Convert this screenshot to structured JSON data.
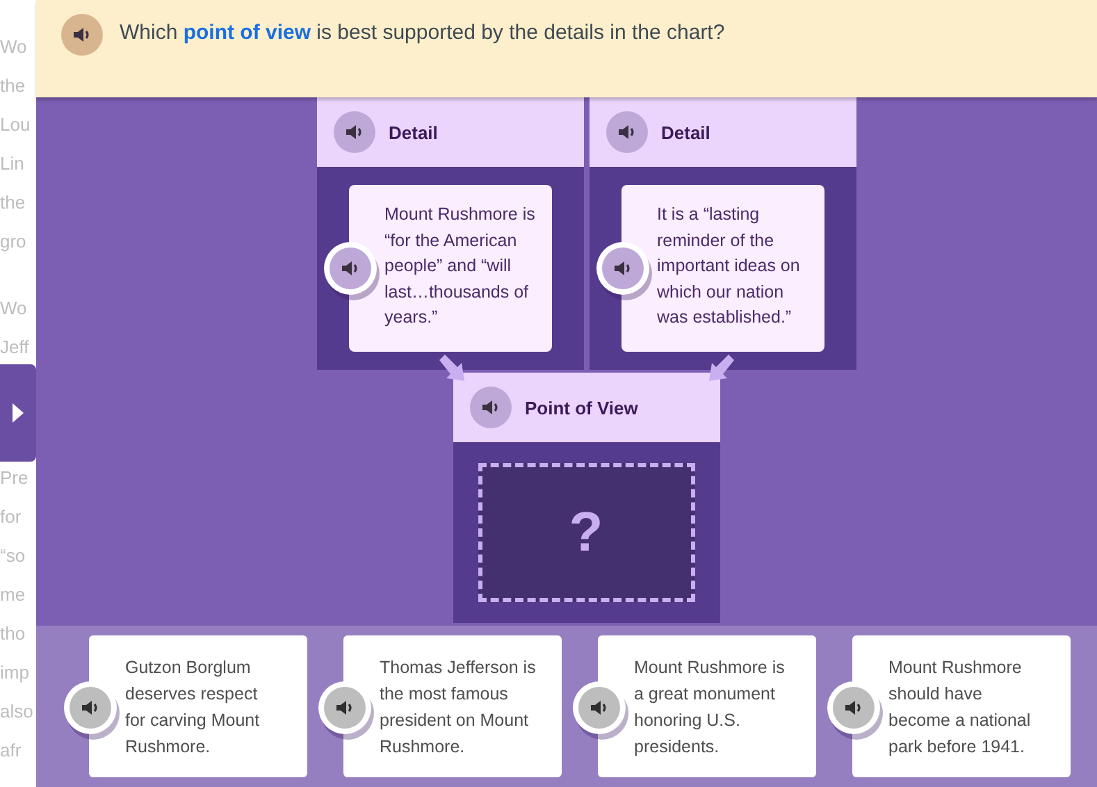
{
  "background_text": {
    "paragraphs": [
      [
        "Wo",
        "the",
        "Lou",
        "Lin",
        "the",
        "gro"
      ],
      [
        "Wo",
        "Jeff"
      ],
      [
        "Pre",
        "for",
        "“so",
        "me",
        "tho",
        "imp",
        "also",
        "afr"
      ]
    ]
  },
  "question": {
    "text": "Which **point of view** is best supported by the details in the chart?"
  },
  "chart": {
    "details": [
      {
        "heading": "Detail",
        "text": "Mount Rushmore is “for the American people” and “will last…thousands of years.”"
      },
      {
        "heading": "Detail",
        "text": "It is a “lasting reminder of the important ideas on which our nation was established.”"
      }
    ],
    "result": {
      "heading": "Point of View",
      "empty_mark": "?"
    }
  },
  "answers": [
    {
      "text": "Gutzon Borglum deserves respect for carving Mount Rushmore."
    },
    {
      "text": "Thomas Jefferson is the most famous president on Mount Rushmore."
    },
    {
      "text": "Mount Rushmore is a great monument honoring U.S. presidents."
    },
    {
      "text": "Mount Rushmore should have become a national park before 1941."
    }
  ]
}
